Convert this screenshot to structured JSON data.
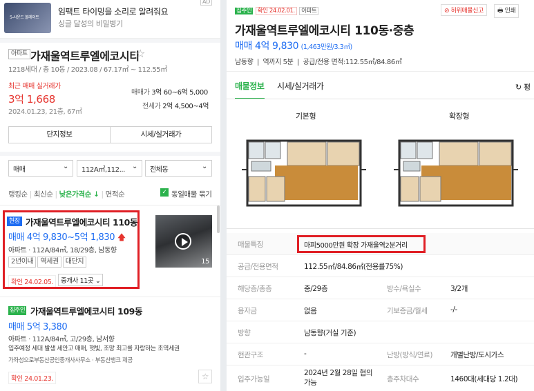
{
  "left": {
    "ad": {
      "badge": "AD",
      "title": "임팩트 타이밍을 소리로 알려줘요",
      "subtitle": "싱글 달성의 비밀병기",
      "thumb_text": "5-사운드 볼레이트"
    },
    "complex": {
      "type_tag": "아파트",
      "name": "가재울역트루엘에코시티",
      "meta": "1218세대 / 총 10동 / 2023.08 / 67.17㎡ ~ 112.55㎡",
      "recent_label": "최근 매매 실거래가",
      "recent_price": "3억 1,668",
      "recent_date": "2024.01.23, 21층, 67㎡",
      "sale_label": "매매가",
      "sale_range": "3억 60~6억 5,000",
      "jeonse_label": "전세가",
      "jeonse_range": "2억 4,500~4억",
      "btn_info": "단지정보",
      "btn_trade": "시세/실거래가"
    },
    "filters": {
      "deal": "매매",
      "area": "112A㎡,112...",
      "dong": "전체동"
    },
    "sort": {
      "items": [
        "랭킹순",
        "최신순",
        "낮은가격순 ↓",
        "면적순"
      ],
      "same": "동일매물 묶기"
    },
    "listing1": {
      "tag": "현장",
      "name": "가재울역트루엘에코시티 110동",
      "price": "매매 4억 9,830~5억 1,830",
      "desc": "아파트 · 112A/84㎡, 18/29층, 남동향",
      "chips": [
        "2년이내",
        "역세권",
        "대단지"
      ],
      "confirm": "확인 24.02.05.",
      "agents": "중개사 11곳",
      "photo_count": "15"
    },
    "listing2": {
      "tag": "집주인",
      "name": "가재울역트루엘에코시티 109동",
      "price": "매매 5억 3,380",
      "desc": "아파트 · 112A/84㎡, 고/29층, 남서향",
      "desc2": "입주예정 세대 발생 세안고 매매, 햇빛, 조망 최고를 자랑하는 초역세권",
      "agent": "가좌성으로부동산공인중개사사무소 · 부동산뱅크 제공",
      "confirm": "확인 24.01.23."
    }
  },
  "right": {
    "header": {
      "owner_tag": "집주인",
      "confirm_tag": "확인 24.02.01.",
      "type_tag": "아파트",
      "report": "허위매물신고",
      "print": "인쇄"
    },
    "title": "가재울역트루엘에코시티 110동·중층",
    "price": "매매 4억 9,830",
    "price_per": "(1,463만원/3.3㎡)",
    "summary": "남동향  |  역까지 5분  |  공급/전용 면적:112.55㎡/84.86㎡",
    "tabs": [
      "매물정보",
      "시세/실거래가"
    ],
    "share": "평",
    "plan_labels": [
      "기본형",
      "확장형"
    ],
    "feature": {
      "label": "매물특징",
      "value": "마피5000만원 확장 가재울역2분거리"
    },
    "rows": [
      {
        "k1": "공급/전용면적",
        "v1": "112.55㎡/84.86㎡(전용률75%)",
        "k2": "",
        "v2": ""
      },
      {
        "k1": "해당층/총층",
        "v1": "중/29층",
        "k2": "방수/욕실수",
        "v2": "3/2개"
      },
      {
        "k1": "융자금",
        "v1": "없음",
        "k2": "기보증금/월세",
        "v2": "-/-"
      },
      {
        "k1": "방향",
        "v1": "남동향(거실 기준)",
        "k2": "",
        "v2": ""
      },
      {
        "k1": "현관구조",
        "v1": "-",
        "k2": "난방(방식/연료)",
        "v2": "개별난방/도시가스"
      },
      {
        "k1": "입주가능일",
        "v1": "2024년 2월 28일 협의 가능",
        "k2": "총주차대수",
        "v2": "1460대(세대당 1.2대)"
      }
    ]
  }
}
